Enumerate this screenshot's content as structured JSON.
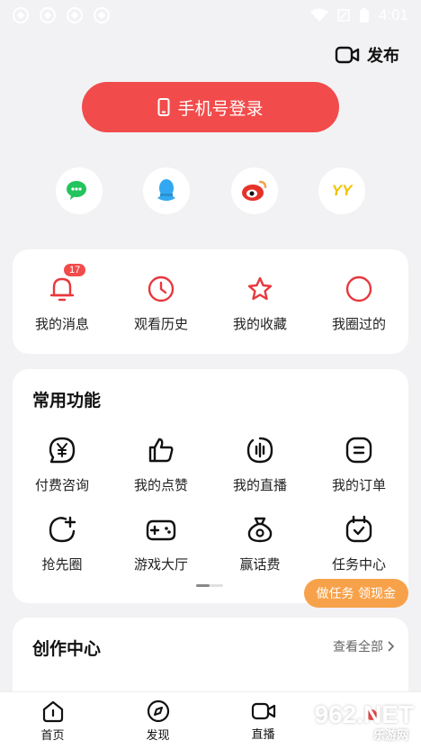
{
  "status_bar": {
    "time": "4:01"
  },
  "publish_label": "发布",
  "login_label": "手机号登录",
  "social_logins": [
    {
      "name": "wechat",
      "color": "#23c45d"
    },
    {
      "name": "qq",
      "color": "#33a8f0"
    },
    {
      "name": "weibo",
      "color": "#e6332a"
    },
    {
      "name": "yy",
      "label": "YY",
      "color": "#f2c200"
    }
  ],
  "quick": [
    {
      "label": "我的消息",
      "icon": "bell-icon",
      "badge": "17"
    },
    {
      "label": "观看历史",
      "icon": "clock-icon"
    },
    {
      "label": "我的收藏",
      "icon": "star-icon"
    },
    {
      "label": "我圈过的",
      "icon": "circle-icon"
    }
  ],
  "common": {
    "title": "常用功能",
    "items": [
      {
        "label": "付费咨询",
        "icon": "yuan-chat-icon"
      },
      {
        "label": "我的点赞",
        "icon": "thumb-up-icon"
      },
      {
        "label": "我的直播",
        "icon": "live-icon"
      },
      {
        "label": "我的订单",
        "icon": "order-icon"
      },
      {
        "label": "抢先圈",
        "icon": "circle-plus-icon"
      },
      {
        "label": "游戏大厅",
        "icon": "gamepad-icon"
      },
      {
        "label": "赢话费",
        "icon": "money-bag-icon"
      },
      {
        "label": "任务中心",
        "icon": "task-calendar-icon"
      }
    ],
    "task_pill": "做任务 领现金"
  },
  "creation": {
    "title": "创作中心",
    "see_all": "查看全部"
  },
  "tabs": [
    {
      "label": "首页",
      "icon": "home-icon"
    },
    {
      "label": "发现",
      "icon": "compass-icon"
    },
    {
      "label": "直播",
      "icon": "video-icon"
    },
    {
      "label": "",
      "icon": "me-icon"
    }
  ],
  "watermark": {
    "brand": "962.NET",
    "sub": "乐游网"
  },
  "colors": {
    "accent": "#f24b4b",
    "pill": "#f7a24a"
  }
}
